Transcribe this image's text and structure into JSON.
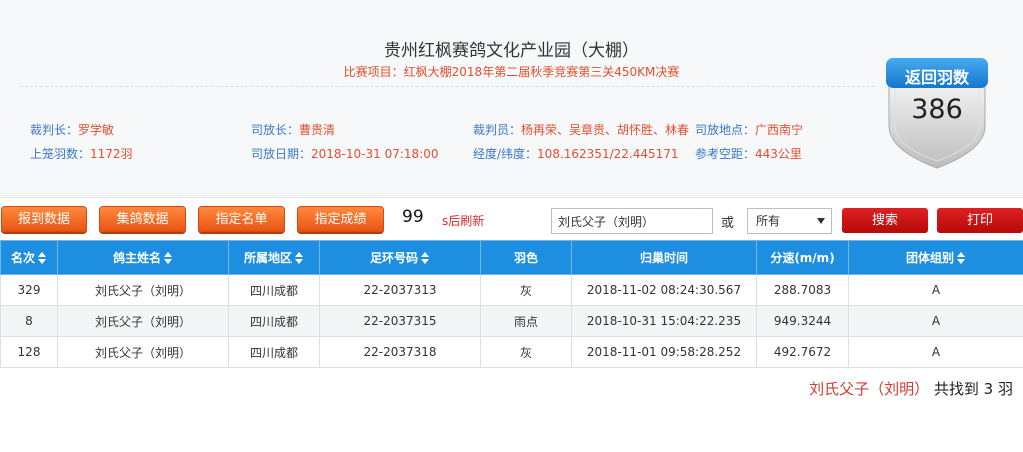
{
  "header": {
    "title": "贵州红枫赛鸽文化产业园（大棚）",
    "subtitle": "比赛项目：红枫大棚2018年第二届秋季竞赛第三关450KM决赛"
  },
  "info": {
    "chief_referee": {
      "label": "裁判长：",
      "value": "罗学敏"
    },
    "release_chief": {
      "label": "司放长：",
      "value": "曹贵清"
    },
    "referees": {
      "label": "裁判员：",
      "value": "杨再荣、吴章贵、胡怀胜、林春"
    },
    "release_place": {
      "label": "司放地点：",
      "value": "广西南宁"
    },
    "caged": {
      "label": "上笼羽数：",
      "value": "1172羽"
    },
    "release_date": {
      "label": "司放日期：",
      "value": "2018-10-31 07:18:00"
    },
    "coords": {
      "label": "经度/纬度：",
      "value": "108.162351/22.445171"
    },
    "distance": {
      "label": "参考空距：",
      "value": "443公里"
    }
  },
  "badge": {
    "label": "返回羽数",
    "count": "386",
    "color": "#1f8fe0"
  },
  "toolbar": {
    "report_data": "报到数据",
    "collect_data": "集鸽数据",
    "named_list": "指定名单",
    "named_results": "指定成绩",
    "refresh_seconds": "99",
    "refresh_suffix": "s后刷新",
    "search_value": "刘氏父子（刘明）",
    "or_label": "或",
    "select_value": "所有",
    "search_button": "搜索",
    "print_button": "打印"
  },
  "table": {
    "headers": {
      "rank": "名次",
      "owner": "鸽主姓名",
      "region": "所属地区",
      "ring": "足环号码",
      "color": "羽色",
      "arrival": "归巢时间",
      "speed": "分速(m/m)",
      "group": "团体组别"
    },
    "rows": [
      {
        "rank": "329",
        "owner": "刘氏父子（刘明）",
        "region": "四川成都",
        "ring": "22-2037313",
        "color": "灰",
        "arrival": "2018-11-02 08:24:30.567",
        "speed": "288.7083",
        "group": "A"
      },
      {
        "rank": "8",
        "owner": "刘氏父子（刘明）",
        "region": "四川成都",
        "ring": "22-2037315",
        "color": "雨点",
        "arrival": "2018-10-31 15:04:22.235",
        "speed": "949.3244",
        "group": "A"
      },
      {
        "rank": "128",
        "owner": "刘氏父子（刘明）",
        "region": "四川成都",
        "ring": "22-2037318",
        "color": "灰",
        "arrival": "2018-11-01 09:58:28.252",
        "speed": "492.7672",
        "group": "A"
      }
    ]
  },
  "result": {
    "name": "刘氏父子（刘明）",
    "text": " 共找到 3 羽"
  },
  "colors": {
    "accent_blue": "#1e8fe0",
    "orange": "#ea5413",
    "red": "#d6392e"
  }
}
